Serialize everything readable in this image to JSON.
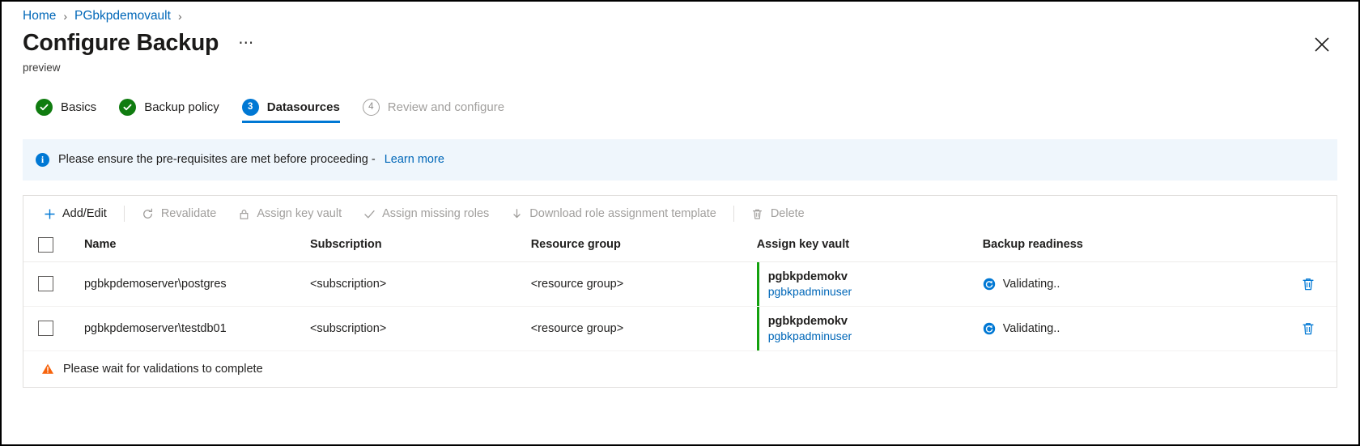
{
  "breadcrumb": {
    "items": [
      {
        "label": "Home"
      },
      {
        "label": "PGbkpdemovault"
      }
    ],
    "separator": "›"
  },
  "header": {
    "title": "Configure Backup",
    "subtitle": "preview",
    "more_label": "⋯",
    "close_label": "Close"
  },
  "wizard": {
    "steps": [
      {
        "number": "1",
        "label": "Basics",
        "state": "done"
      },
      {
        "number": "2",
        "label": "Backup policy",
        "state": "done"
      },
      {
        "number": "3",
        "label": "Datasources",
        "state": "active"
      },
      {
        "number": "4",
        "label": "Review and configure",
        "state": "todo"
      }
    ]
  },
  "info_banner": {
    "icon_char": "i",
    "text": "Please ensure the pre-requisites are met before proceeding - ",
    "link_label": "Learn more"
  },
  "toolbar": {
    "buttons": [
      {
        "label": "Add/Edit",
        "icon": "plus-icon",
        "enabled": true
      },
      {
        "label": "Revalidate",
        "icon": "refresh-icon",
        "enabled": false
      },
      {
        "label": "Assign key vault",
        "icon": "lock-icon",
        "enabled": false
      },
      {
        "label": "Assign missing roles",
        "icon": "check-icon",
        "enabled": false
      },
      {
        "label": "Download role assignment template",
        "icon": "download-icon",
        "enabled": false
      },
      {
        "label": "Delete",
        "icon": "trash-icon",
        "enabled": false
      }
    ]
  },
  "table": {
    "columns": [
      "Name",
      "Subscription",
      "Resource group",
      "Assign key vault",
      "Backup readiness"
    ],
    "rows": [
      {
        "name": "pgbkpdemoserver\\postgres",
        "subscription": "<subscription>",
        "resource_group": "<resource group>",
        "key_vault": "pgbkpdemokv",
        "key_vault_user": "pgbkpadminuser",
        "readiness": "Validating..",
        "delete_label": "Delete row"
      },
      {
        "name": "pgbkpdemoserver\\testdb01",
        "subscription": "<subscription>",
        "resource_group": "<resource group>",
        "key_vault": "pgbkpdemokv",
        "key_vault_user": "pgbkpadminuser",
        "readiness": "Validating..",
        "delete_label": "Delete row"
      }
    ]
  },
  "footer": {
    "warning_text": "Please wait for validations to complete"
  },
  "colors": {
    "accent": "#0078d4",
    "link": "#0067b8",
    "success": "#107c10",
    "kv_bar": "#13a10e",
    "warning": "#f7630c",
    "banner_bg": "#eff6fc"
  }
}
